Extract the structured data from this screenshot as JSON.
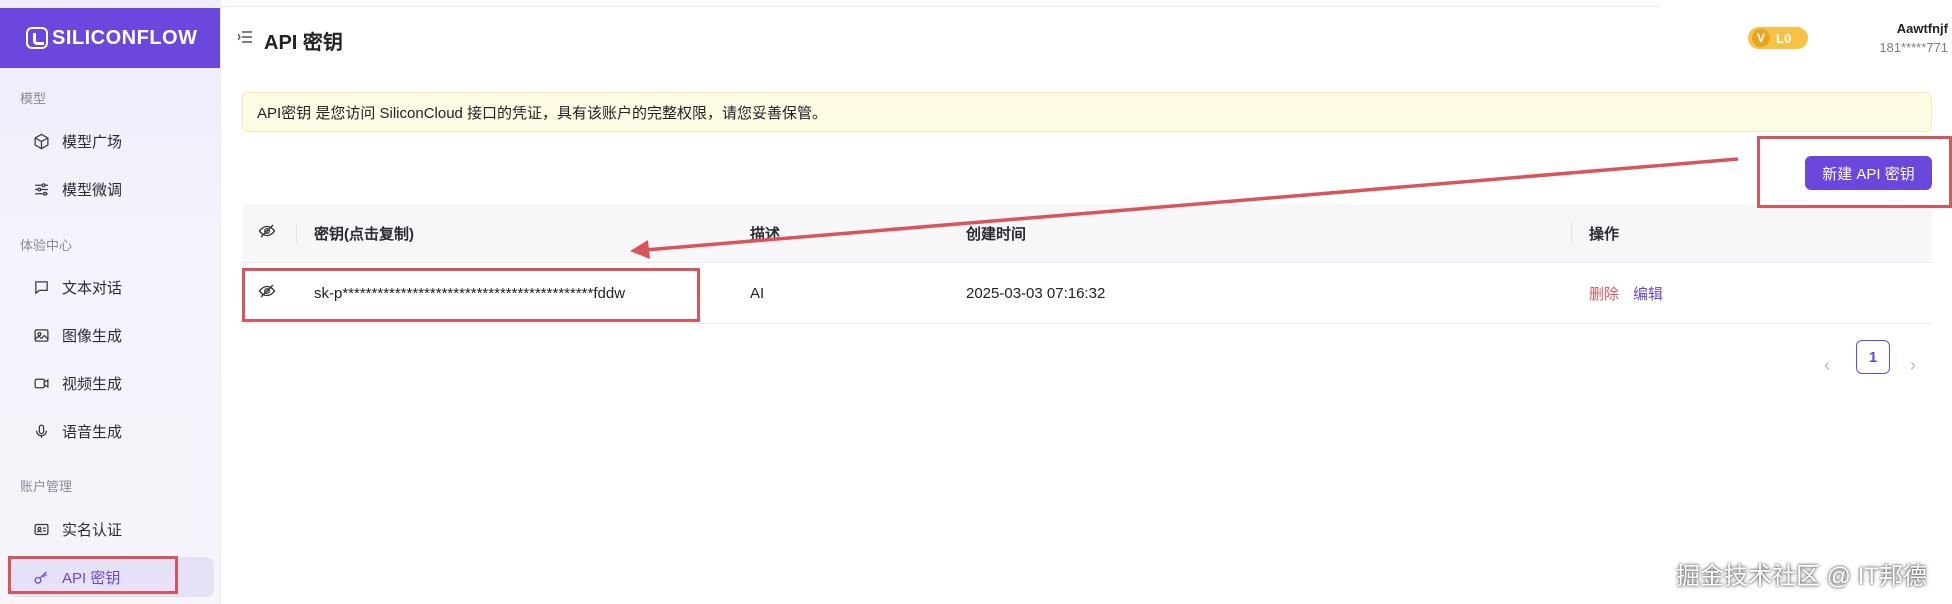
{
  "brand": {
    "name": "SILICONFLOW"
  },
  "sidebar": {
    "sections": [
      {
        "label": "模型",
        "items": [
          {
            "label": "模型广场",
            "icon": "cube-icon"
          },
          {
            "label": "模型微调",
            "icon": "sliders-icon"
          }
        ]
      },
      {
        "label": "体验中心",
        "items": [
          {
            "label": "文本对话",
            "icon": "chat-icon"
          },
          {
            "label": "图像生成",
            "icon": "image-icon"
          },
          {
            "label": "视频生成",
            "icon": "video-icon"
          },
          {
            "label": "语音生成",
            "icon": "mic-icon"
          }
        ]
      },
      {
        "label": "账户管理",
        "items": [
          {
            "label": "实名认证",
            "icon": "id-card-icon"
          },
          {
            "label": "API 密钥",
            "icon": "key-icon",
            "active": true
          }
        ]
      }
    ]
  },
  "header": {
    "title": "API 密钥",
    "level_badge": {
      "v": "V",
      "level": "L0"
    },
    "user": {
      "name": "Aawtfnjf",
      "phone": "181*****771"
    }
  },
  "notice": "API密钥 是您访问 SiliconCloud 接口的凭证，具有该账户的完整权限，请您妥善保管。",
  "new_key_button": "新建 API 密钥",
  "table": {
    "columns": [
      "密钥(点击复制)",
      "描述",
      "创建时间",
      "操作"
    ],
    "rows": [
      {
        "key": "sk-p*******************************************fddw",
        "description": "AI",
        "created": "2025-03-03 07:16:32",
        "actions": {
          "delete": "删除",
          "edit": "编辑"
        }
      }
    ]
  },
  "pagination": {
    "current": "1",
    "prev": "‹",
    "next": "›"
  },
  "watermark": "掘金技术社区 @ IT邦德",
  "colors": {
    "accent": "#6b47de",
    "annotation_red": "#d9545b",
    "notice_bg": "#fefbe5",
    "badge": "#f5c244"
  }
}
